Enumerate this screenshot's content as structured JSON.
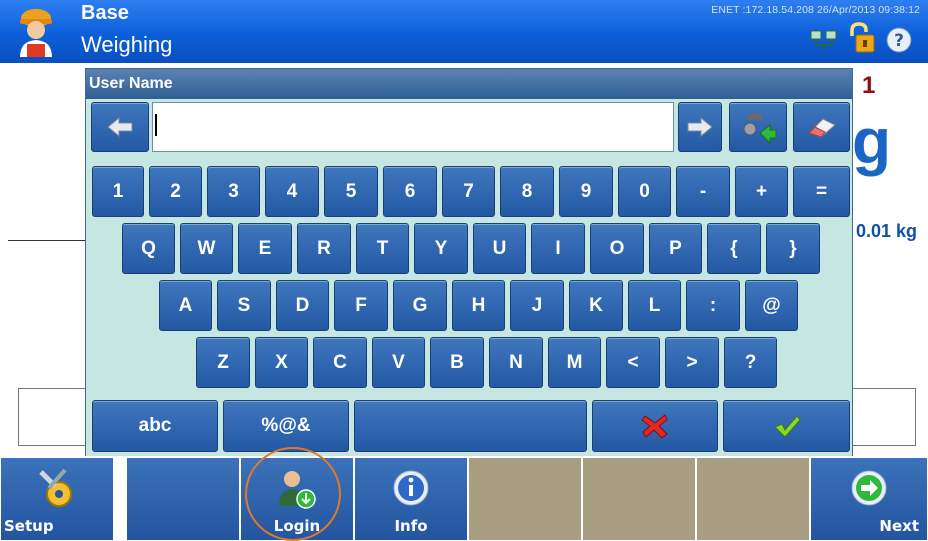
{
  "header": {
    "title": "Base",
    "subtitle": "Weighing",
    "status": "ENET :172.18.54.208  26/Apr/2013 09:38:12",
    "icons": [
      "worker-icon",
      "network-icon",
      "lock-icon",
      "help-icon"
    ]
  },
  "background": {
    "scale_number": "1",
    "unit": "g",
    "resolution": "0.01 kg"
  },
  "dialog": {
    "title": "User Name",
    "input_value": "",
    "row1": [
      "1",
      "2",
      "3",
      "4",
      "5",
      "6",
      "7",
      "8",
      "9",
      "0",
      "-",
      "+",
      "="
    ],
    "row2": [
      "Q",
      "W",
      "E",
      "R",
      "T",
      "Y",
      "U",
      "I",
      "O",
      "P",
      "{",
      "}"
    ],
    "row3": [
      "A",
      "S",
      "D",
      "F",
      "G",
      "H",
      "J",
      "K",
      "L",
      ":",
      "@"
    ],
    "row4": [
      "Z",
      "X",
      "C",
      "V",
      "B",
      "N",
      "M",
      "<",
      ">",
      "?"
    ],
    "bottom": {
      "abc": "abc",
      "symbols": "%@&"
    },
    "icons": [
      "arrow-left-icon",
      "arrow-right-icon",
      "import-icon",
      "eraser-icon",
      "cancel-x-icon",
      "confirm-check-icon"
    ]
  },
  "softkeys": {
    "setup": "Setup",
    "login": "Login",
    "info": "Info",
    "next": "Next"
  },
  "colors": {
    "header_blue": "#0c5fd9",
    "key_blue": "#2f62ad",
    "dialog_bg": "#c6e6e2",
    "disabled_softkey": "#a89e82",
    "highlight": "#e07a2a"
  }
}
